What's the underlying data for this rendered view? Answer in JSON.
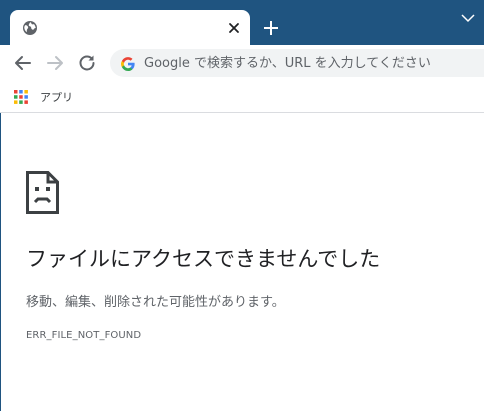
{
  "tab": {
    "title": "",
    "favicon": "globe-icon",
    "close_icon": "close-icon"
  },
  "tabstrip": {
    "new_tab_icon": "plus-icon",
    "tab_search_icon": "chevron-down-icon",
    "background_color": "#1f5480"
  },
  "toolbar": {
    "back_icon": "back-arrow-icon",
    "forward_icon": "forward-arrow-icon",
    "reload_icon": "reload-icon"
  },
  "omnibox": {
    "value": "",
    "placeholder": "Google で検索するか、URL を入力してください",
    "search_engine_icon": "google-g-icon"
  },
  "bookmarks": {
    "apps_label": "アプリ",
    "apps_icon": "apps-grid-icon"
  },
  "error": {
    "icon": "broken-file-icon",
    "title": "ファイルにアクセスできませんでした",
    "description": "移動、編集、削除された可能性があります。",
    "code": "ERR_FILE_NOT_FOUND"
  }
}
